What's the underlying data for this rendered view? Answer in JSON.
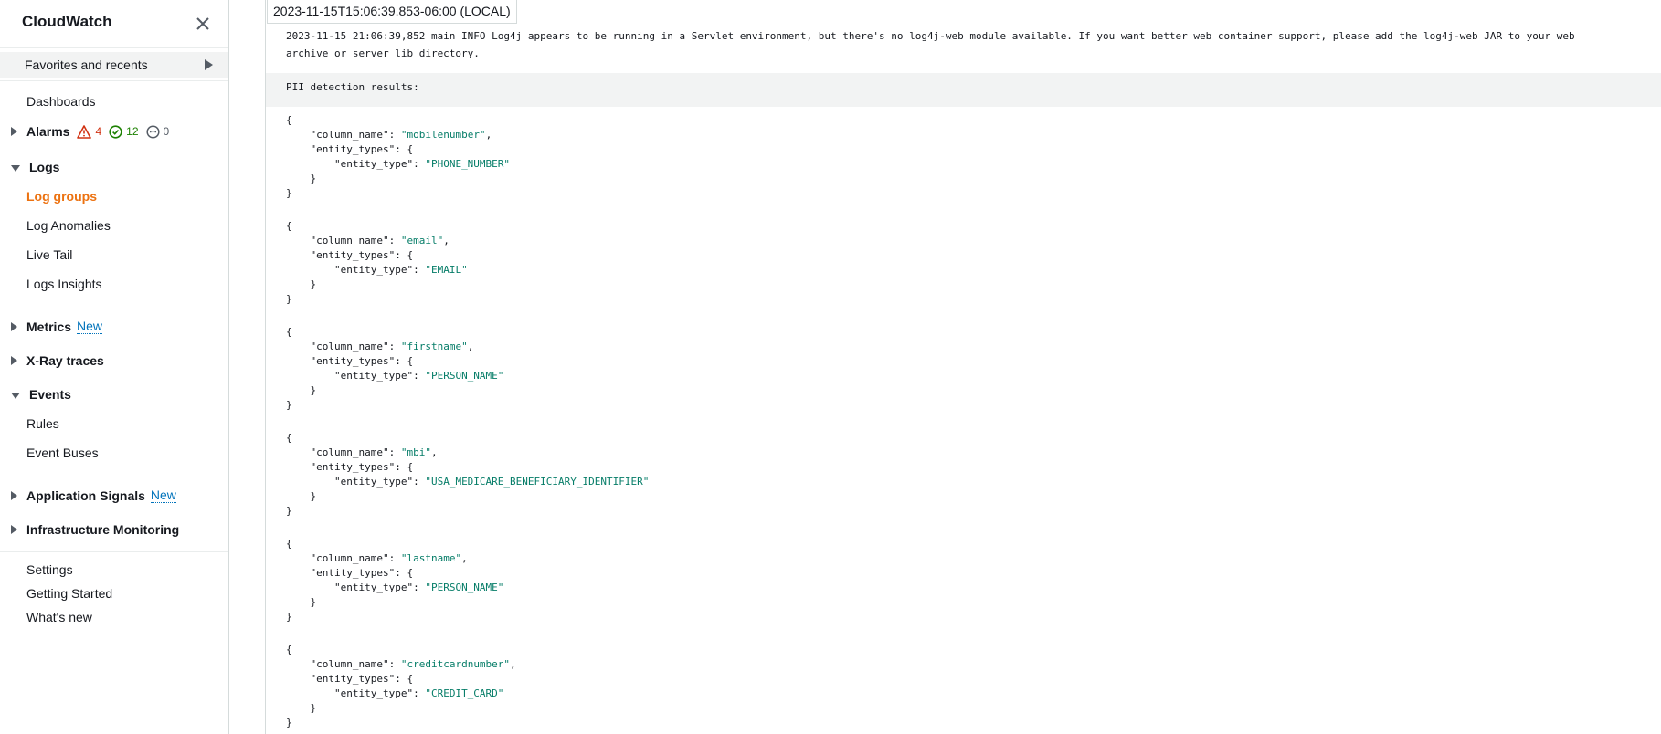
{
  "sidebar": {
    "title": "CloudWatch",
    "favorites_label": "Favorites and recents",
    "dashboards": "Dashboards",
    "alarms": {
      "label": "Alarms",
      "in_alarm": "4",
      "ok": "12",
      "insufficient": "0"
    },
    "logs": {
      "label": "Logs",
      "items": [
        "Log groups",
        "Log Anomalies",
        "Live Tail",
        "Logs Insights"
      ],
      "active": "Log groups"
    },
    "metrics": {
      "label": "Metrics",
      "tag": "New"
    },
    "xray": {
      "label": "X-Ray traces"
    },
    "events": {
      "label": "Events",
      "items": [
        "Rules",
        "Event Buses"
      ]
    },
    "app_signals": {
      "label": "Application Signals",
      "tag": "New"
    },
    "infra": {
      "label": "Infrastructure Monitoring"
    },
    "footer": [
      "Settings",
      "Getting Started",
      "What's new"
    ],
    "colors": {
      "active": "#ec7211",
      "link": "#0073bb",
      "alarm": "#d13212",
      "ok": "#1d8102"
    }
  },
  "log": {
    "timestamp_tooltip": "2023-11-15T15:06:39.853-06:00 (LOCAL)",
    "message": "2023-11-15 21:06:39,852 main INFO Log4j appears to be running in a Servlet environment, but there's no log4j-web module available. If you want better web container support, please add the log4j-web JAR to your web\narchive or server lib directory.",
    "pii_header": "PII detection results:",
    "results": [
      {
        "column_name": "mobilenumber",
        "entity_type": "PHONE_NUMBER"
      },
      {
        "column_name": "email",
        "entity_type": "EMAIL"
      },
      {
        "column_name": "firstname",
        "entity_type": "PERSON_NAME"
      },
      {
        "column_name": "mbi",
        "entity_type": "USA_MEDICARE_BENEFICIARY_IDENTIFIER"
      },
      {
        "column_name": "lastname",
        "entity_type": "PERSON_NAME"
      },
      {
        "column_name": "creditcardnumber",
        "entity_type": "CREDIT_CARD"
      }
    ],
    "json_keys": {
      "column_name": "column_name",
      "entity_types": "entity_types",
      "entity_type": "entity_type"
    }
  }
}
